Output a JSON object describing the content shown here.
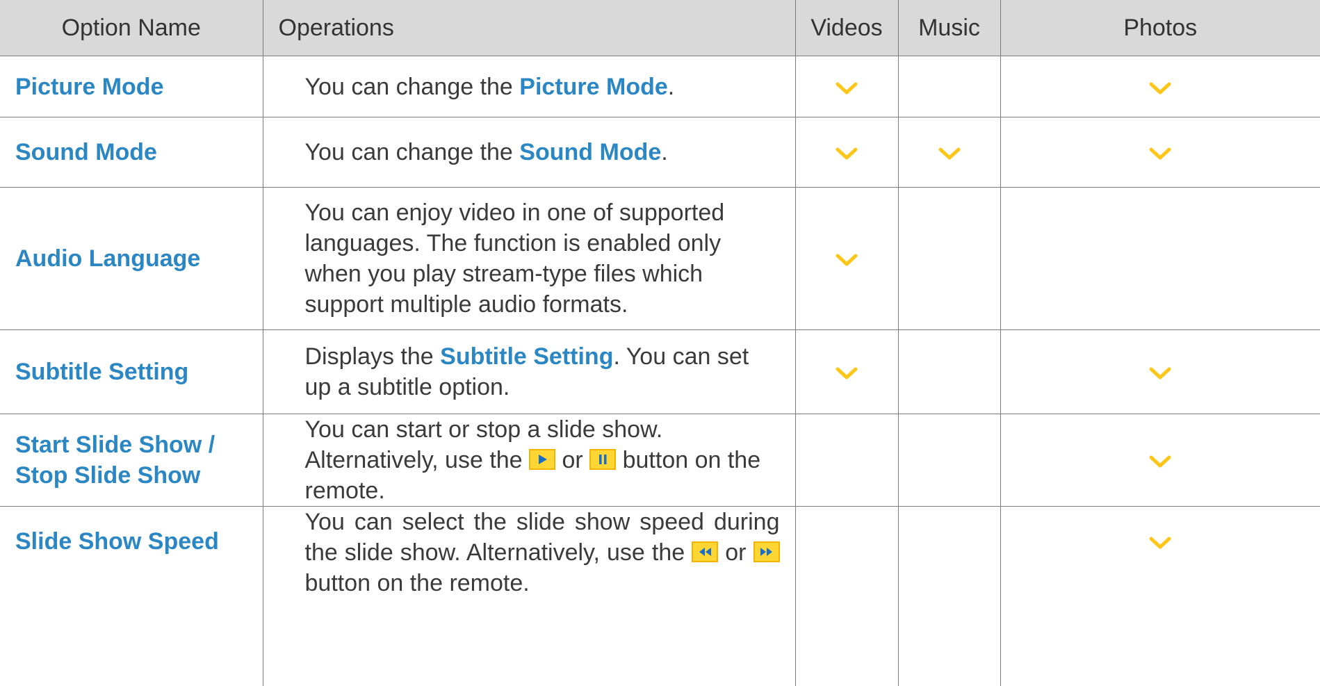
{
  "headers": {
    "option_name": "Option Name",
    "operations": "Operations",
    "videos": "Videos",
    "music": "Music",
    "photos": "Photos"
  },
  "colors": {
    "option_name_blue": "#2b86c4",
    "checkmark_yellow": "#ffc61a",
    "header_background": "#d9d9d9"
  },
  "rows": [
    {
      "name": "Picture Mode",
      "ops": {
        "a": "You can change the ",
        "b": "Picture Mode",
        "c": "."
      },
      "videos": true,
      "music": false,
      "photos": true
    },
    {
      "name": "Sound Mode",
      "ops": {
        "a": "You can change the ",
        "b": "Sound Mode",
        "c": "."
      },
      "videos": true,
      "music": true,
      "photos": true
    },
    {
      "name": "Audio Language",
      "ops": {
        "a": "You can enjoy video in one of supported languages. The function is enabled only when you play stream-type files which support multiple audio formats."
      },
      "videos": true,
      "music": false,
      "photos": false
    },
    {
      "name": "Subtitle Setting",
      "ops": {
        "a": "Displays the ",
        "b": "Subtitle Setting",
        "c": ". You can set up a subtitle option."
      },
      "videos": true,
      "music": false,
      "photos": true
    },
    {
      "name_line1": "Start Slide Show /",
      "name_line2": "Stop Slide Show",
      "ops": {
        "a": "You can start or stop a slide show. Alternatively, use the ",
        "b": " or ",
        "c": " button on the remote."
      },
      "icons": [
        "play-button-icon",
        "pause-button-icon"
      ],
      "videos": false,
      "music": false,
      "photos": true
    },
    {
      "name": "Slide Show Speed",
      "ops": {
        "a": "You can select the slide show speed during the slide show. Alternatively, use the ",
        "b": " or ",
        "c": " button on the remote."
      },
      "icons": [
        "rewind-button-icon",
        "fast-forward-button-icon"
      ],
      "videos": false,
      "music": false,
      "photos": true
    }
  ]
}
